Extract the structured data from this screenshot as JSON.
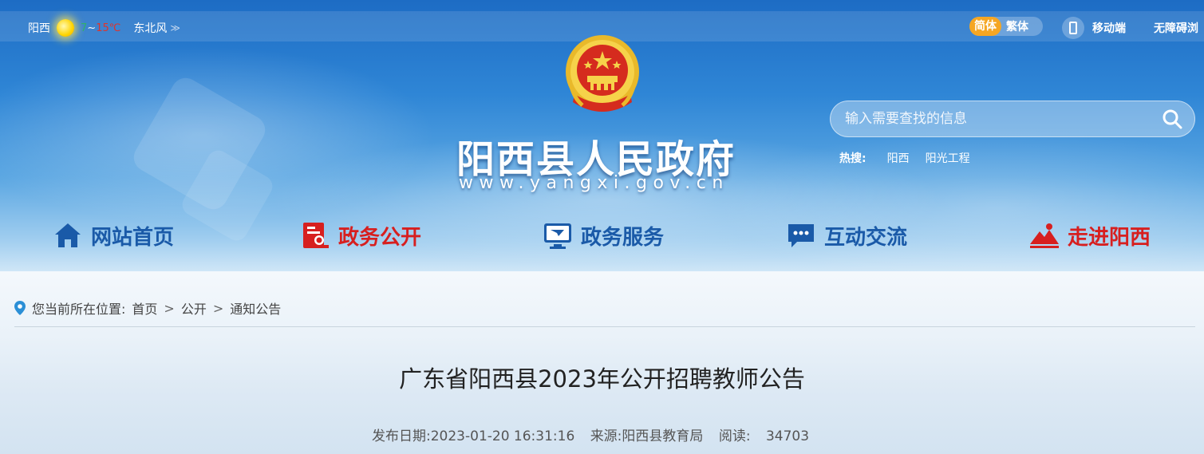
{
  "topbar": {
    "city": "阳西",
    "temp_low": "7",
    "temp_sep": "~",
    "temp_high": "15℃",
    "wind": "东北风",
    "wind_arrow": "≫",
    "lang_simplified": "简体",
    "lang_traditional": "繁体",
    "mobile": "移动端",
    "accessibility": "无障碍浏"
  },
  "header": {
    "site_title": "阳西县人民政府",
    "site_url": "www.yangxi.gov.cn",
    "search_placeholder": "输入需要查找的信息",
    "hot_label": "热搜:",
    "hot_items": [
      "阳西",
      "阳光工程"
    ]
  },
  "nav": [
    {
      "label": "网站首页",
      "icon": "home-icon"
    },
    {
      "label": "政务公开",
      "icon": "document-icon"
    },
    {
      "label": "政务服务",
      "icon": "screen-icon"
    },
    {
      "label": "互动交流",
      "icon": "chat-icon"
    },
    {
      "label": "走进阳西",
      "icon": "mountain-icon"
    }
  ],
  "breadcrumb": {
    "prefix": "您当前所在位置:",
    "items": [
      "首页",
      "公开",
      "通知公告"
    ],
    "separator": ">"
  },
  "article": {
    "title": "广东省阳西县2023年公开招聘教师公告",
    "date": "发布日期:2023-01-20 16:31:16",
    "source": "来源:阳西县教育局",
    "reads_label": "阅读:",
    "reads": "34703"
  },
  "colors": {
    "nav_blue": "#1a5aa8",
    "nav_red": "#d71f1f",
    "lang_active": "#f5a623"
  }
}
